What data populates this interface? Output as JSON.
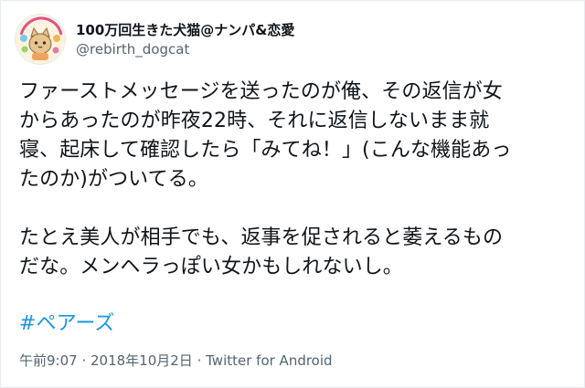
{
  "user": {
    "display_name": "100万回生きた犬猫@ナンパ&恋愛",
    "handle": "@rebirth_dogcat",
    "avatar_icon": "cartoon-cat-avatar"
  },
  "tweet": {
    "lines_p1": [
      "ファーストメッセージを送ったのが俺、その返信が女",
      "からあったのが昨夜22時、それに返信しないまま就",
      "寝、起床して確認したら「みてね！」(こんな機能あっ",
      "たのか)がついてる。"
    ],
    "lines_p2": [
      "たとえ美人が相手でも、返事を促されると萎えるもの",
      "だな。メンヘラっぽい女かもしれないし。"
    ],
    "hashtag": "#ペアーズ"
  },
  "meta": {
    "time": "午前9:07",
    "sep1": " · ",
    "date": "2018年10月2日",
    "sep2": " · ",
    "source": "Twitter for Android"
  },
  "colors": {
    "text": "#0f1419",
    "secondary": "#536471",
    "link": "#1b95e0"
  }
}
